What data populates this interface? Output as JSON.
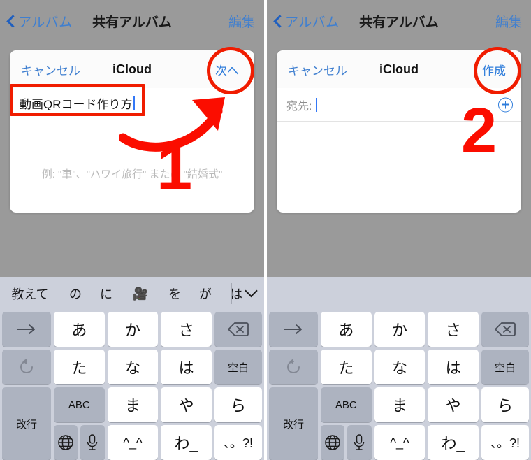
{
  "navbar": {
    "back_label": "アルバム",
    "title": "共有アルバム",
    "edit_label": "編集",
    "back_icon": "chevron-left-icon",
    "link_color": "#3f7fd0"
  },
  "left_panel": {
    "card": {
      "cancel_label": "キャンセル",
      "title": "iCloud",
      "action_label": "次へ",
      "input_value": "動画QRコード作り方",
      "hint_text": "例: \"車\"、\"ハワイ旅行\" または \"結婚式\""
    },
    "annotation": {
      "step_number": "1",
      "color": "#fb0d00",
      "highlight_target": "album-name-input",
      "circle_target": "next-button",
      "arrow": "curved-arrow-up-right"
    }
  },
  "right_panel": {
    "card": {
      "cancel_label": "キャンセル",
      "title": "iCloud",
      "action_label": "作成",
      "to_label": "宛先:",
      "to_value": "",
      "add_contact_icon": "plus-circle-icon"
    },
    "annotation": {
      "step_number": "2",
      "color": "#fb0d00",
      "circle_target": "create-button"
    }
  },
  "keyboard": {
    "suggestions": [
      "教えて",
      "の",
      "に",
      "🎥",
      "を",
      "が",
      "は"
    ],
    "collapse_icon": "chevron-down-icon",
    "rows": [
      [
        {
          "label": "→",
          "style": "gray",
          "name": "cursor-right-key",
          "size": "mid"
        },
        {
          "label": "あ",
          "style": "white",
          "name": "kana-a-key"
        },
        {
          "label": "か",
          "style": "white",
          "name": "kana-ka-key"
        },
        {
          "label": "さ",
          "style": "white",
          "name": "kana-sa-key"
        },
        {
          "label": "⌫",
          "style": "gray",
          "name": "delete-key",
          "size": "mid"
        }
      ],
      [
        {
          "label": "↺",
          "style": "gray",
          "name": "undo-key",
          "size": "mid"
        },
        {
          "label": "た",
          "style": "white",
          "name": "kana-ta-key"
        },
        {
          "label": "な",
          "style": "white",
          "name": "kana-na-key"
        },
        {
          "label": "は",
          "style": "white",
          "name": "kana-ha-key"
        },
        {
          "label": "空白",
          "style": "gray",
          "name": "space-key",
          "size": "lab"
        }
      ],
      [
        {
          "label": "ABC",
          "style": "gray",
          "name": "abc-key",
          "size": "lab"
        },
        {
          "label": "ま",
          "style": "white",
          "name": "kana-ma-key"
        },
        {
          "label": "や",
          "style": "white",
          "name": "kana-ya-key"
        },
        {
          "label": "ら",
          "style": "white",
          "name": "kana-ra-key"
        },
        {
          "label": "改行",
          "style": "gray",
          "name": "return-key",
          "size": "lab"
        }
      ],
      [
        {
          "label": "",
          "style": "gray",
          "name": "globe-mic-keys",
          "size": "lab"
        },
        {
          "label": "^_^",
          "style": "white",
          "name": "emoticon-key",
          "size": "mid"
        },
        {
          "label": "わ_",
          "style": "white",
          "name": "kana-wa-key"
        },
        {
          "label": "、。?!",
          "style": "white",
          "name": "punctuation-key",
          "size": "mid"
        }
      ]
    ],
    "globe_icon": "globe-icon",
    "mic_icon": "microphone-icon"
  },
  "colors": {
    "background": "#9a9a9a",
    "keyboard_bg": "#ccd0db",
    "key_white": "#ffffff",
    "key_gray": "#adb3c0",
    "annotation_red": "#fb0d00",
    "ios_blue": "#2f7ddb"
  }
}
